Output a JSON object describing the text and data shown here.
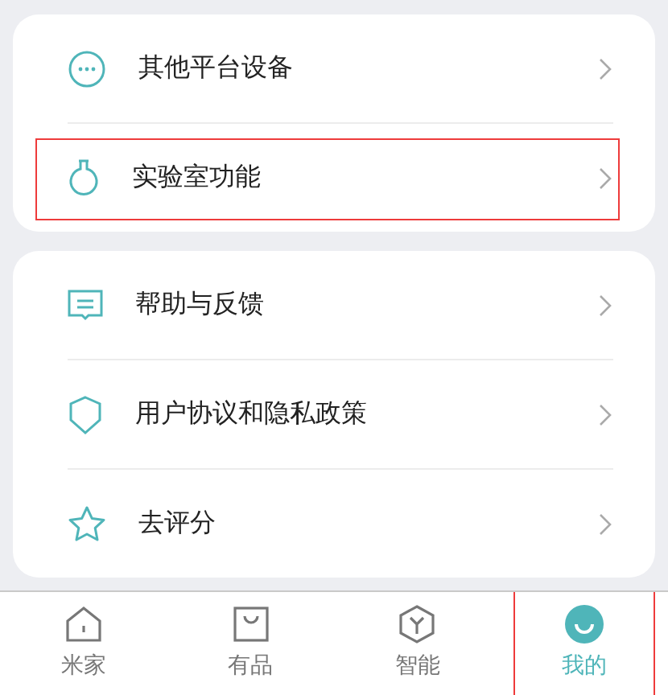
{
  "groups": [
    {
      "items": [
        {
          "label": "其他平台设备",
          "highlighted": false
        },
        {
          "label": "实验室功能",
          "highlighted": true
        }
      ]
    },
    {
      "items": [
        {
          "label": "帮助与反馈",
          "highlighted": false
        },
        {
          "label": "用户协议和隐私政策",
          "highlighted": false
        },
        {
          "label": "去评分",
          "highlighted": false
        }
      ]
    }
  ],
  "tabs": [
    {
      "label": "米家",
      "selected": false,
      "highlighted": false
    },
    {
      "label": "有品",
      "selected": false,
      "highlighted": false
    },
    {
      "label": "智能",
      "selected": false,
      "highlighted": false
    },
    {
      "label": "我的",
      "selected": true,
      "highlighted": true
    }
  ]
}
